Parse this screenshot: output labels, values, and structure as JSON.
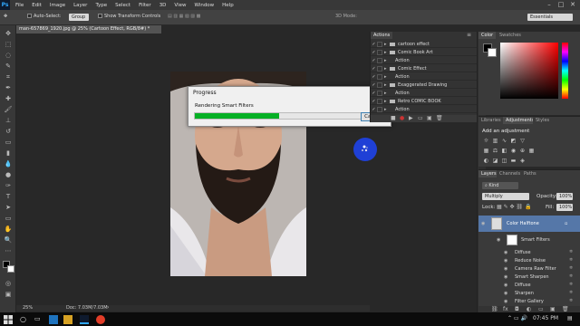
{
  "app": {
    "logo": "Ps"
  },
  "menu": [
    "File",
    "Edit",
    "Image",
    "Layer",
    "Type",
    "Select",
    "Filter",
    "3D",
    "View",
    "Window",
    "Help"
  ],
  "options": {
    "auto_select_label": "Auto-Select:",
    "auto_select_value": "Group",
    "show_transform_label": "Show Transform Controls",
    "mode_3d": "3D Mode:",
    "workspace": "Essentials"
  },
  "document": {
    "tab_title": "man-657869_1920.jpg @ 25% (Cartoon Effect, RGB/8#) *",
    "zoom": "25%",
    "doc_size": "Doc: 7.03M/7.03M"
  },
  "dialog": {
    "title": "Progress",
    "message": "Rendering Smart Filters",
    "cancel_label": "Cancel",
    "progress": 0.5
  },
  "actions_panel": {
    "tab": "Actions",
    "rows": [
      {
        "label": "cartoon effect",
        "kind": "set"
      },
      {
        "label": "Comic Book Art",
        "kind": "set"
      },
      {
        "label": "Action",
        "kind": "action"
      },
      {
        "label": "Comic Effect",
        "kind": "set"
      },
      {
        "label": "Action",
        "kind": "action"
      },
      {
        "label": "Exaggerated Drawing",
        "kind": "set"
      },
      {
        "label": "Action",
        "kind": "action"
      },
      {
        "label": "Retro COMIC BOOK",
        "kind": "set"
      },
      {
        "label": "Action",
        "kind": "action"
      }
    ]
  },
  "color_panel": {
    "tabs": [
      "Color",
      "Swatches"
    ]
  },
  "adjustments_panel": {
    "tabs": [
      "Libraries",
      "Adjustments",
      "Styles"
    ],
    "hint": "Add an adjustment"
  },
  "layers_panel": {
    "tabs": [
      "Layers",
      "Channels",
      "Paths"
    ],
    "kind_filter": "Kind",
    "blend_mode": "Multiply",
    "opacity_label": "Opacity:",
    "opacity_value": "100%",
    "lock_label": "Lock:",
    "fill_label": "Fill:",
    "fill_value": "100%",
    "layer_name": "Color Halftone",
    "smart_filters_label": "Smart Filters",
    "filters": [
      "Diffuse",
      "Reduce Noise",
      "Camera Raw Filter",
      "Smart Sharpen",
      "Diffuse",
      "Sharpen",
      "Filter Gallery"
    ]
  },
  "taskbar": {
    "time": "07:45 PM"
  }
}
